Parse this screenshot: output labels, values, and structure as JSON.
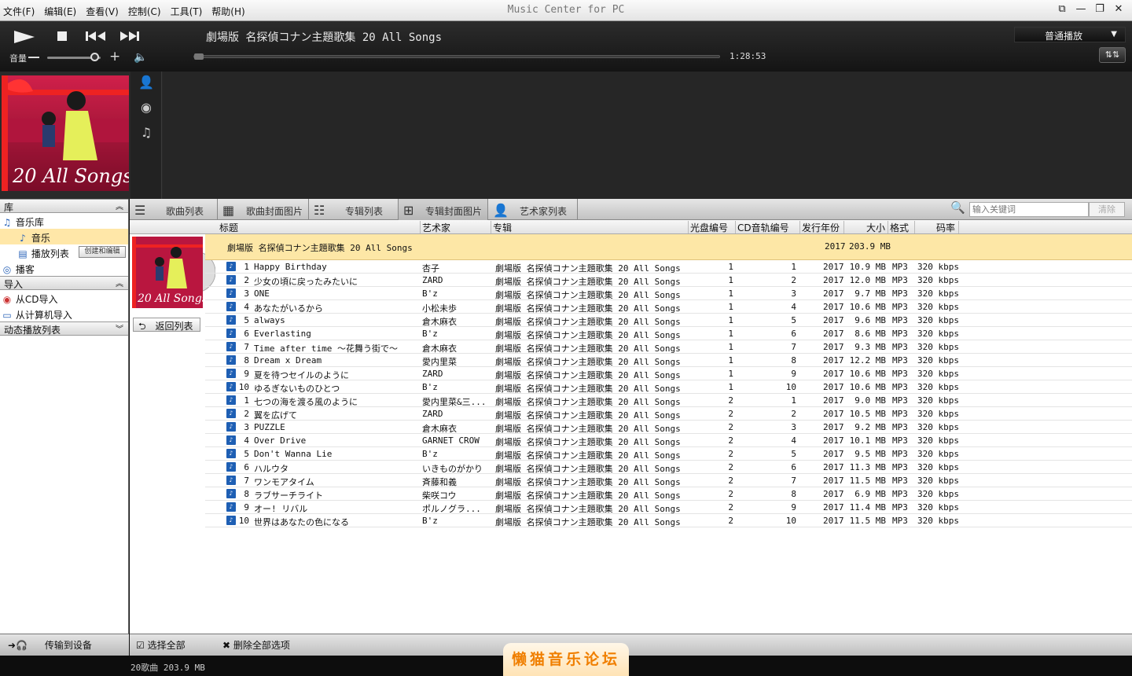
{
  "window": {
    "title": "Music Center for PC",
    "controls": [
      "⧉",
      "—",
      "❐",
      "✕"
    ]
  },
  "menu": [
    "文件(F)",
    "编辑(E)",
    "查看(V)",
    "控制(C)",
    "工具(T)",
    "帮助(H)"
  ],
  "player": {
    "now_playing": "劇場版 名探偵コナン主題歌集 20 All Songs",
    "volume_label": "音量",
    "volume_level": 0.9,
    "position": 0.0,
    "time": "1:28:53",
    "mode": "普通播放",
    "eq_icon": "equalizer-icon"
  },
  "sidebar": {
    "library_header": "库",
    "music_library": "音乐库",
    "music": "音乐",
    "playlists": "播放列表",
    "create_edit": "创建和编辑",
    "podcast": "播客",
    "import_header": "导入",
    "from_cd": "从CD导入",
    "from_pc": "从计算机导入",
    "dynamic_header": "动态播放列表",
    "transfer": "传输到设备"
  },
  "tabs": [
    "歌曲列表",
    "歌曲封面图片",
    "专辑列表",
    "专辑封面图片",
    "艺术家列表"
  ],
  "active_tab": 3,
  "search": {
    "placeholder": "输入关键词",
    "clear": "清除"
  },
  "columns": {
    "title": "标题",
    "artist": "艺术家",
    "album": "专辑",
    "disc": "光盘编号",
    "track": "CD音轨编号",
    "year": "发行年份",
    "size": "大小",
    "format": "格式",
    "bitrate": "码率"
  },
  "album": {
    "name": "劇場版 名探偵コナン主題歌集 20 All Songs",
    "year": "2017",
    "size": "203.9 MB",
    "back": "返回列表"
  },
  "songs": [
    {
      "n": "1",
      "title": "Happy Birthday",
      "artist": "杏子",
      "disc": "1",
      "track": "1",
      "size": "10.9 MB"
    },
    {
      "n": "2",
      "title": "少女の頃に戻ったみたいに",
      "artist": "ZARD",
      "disc": "1",
      "track": "2",
      "size": "12.0 MB"
    },
    {
      "n": "3",
      "title": "ONE",
      "artist": "B'z",
      "disc": "1",
      "track": "3",
      "size": "9.7 MB"
    },
    {
      "n": "4",
      "title": "あなたがいるから",
      "artist": "小松未歩",
      "disc": "1",
      "track": "4",
      "size": "10.6 MB"
    },
    {
      "n": "5",
      "title": "always",
      "artist": "倉木麻衣",
      "disc": "1",
      "track": "5",
      "size": "9.6 MB"
    },
    {
      "n": "6",
      "title": "Everlasting",
      "artist": "B'z",
      "disc": "1",
      "track": "6",
      "size": "8.6 MB"
    },
    {
      "n": "7",
      "title": "Time after time ～花舞う街で～",
      "artist": "倉木麻衣",
      "disc": "1",
      "track": "7",
      "size": "9.3 MB"
    },
    {
      "n": "8",
      "title": "Dream x Dream",
      "artist": "愛内里菜",
      "disc": "1",
      "track": "8",
      "size": "12.2 MB"
    },
    {
      "n": "9",
      "title": "夏を待つセイルのように",
      "artist": "ZARD",
      "disc": "1",
      "track": "9",
      "size": "10.6 MB"
    },
    {
      "n": "10",
      "title": "ゆるぎないものひとつ",
      "artist": "B'z",
      "disc": "1",
      "track": "10",
      "size": "10.6 MB"
    },
    {
      "n": "1",
      "title": "七つの海を渡る風のように",
      "artist": "愛内里菜&三...",
      "disc": "2",
      "track": "1",
      "size": "9.0 MB"
    },
    {
      "n": "2",
      "title": "翼を広げて",
      "artist": "ZARD",
      "disc": "2",
      "track": "2",
      "size": "10.5 MB"
    },
    {
      "n": "3",
      "title": "PUZZLE",
      "artist": "倉木麻衣",
      "disc": "2",
      "track": "3",
      "size": "9.2 MB"
    },
    {
      "n": "4",
      "title": "Over Drive",
      "artist": "GARNET CROW",
      "disc": "2",
      "track": "4",
      "size": "10.1 MB"
    },
    {
      "n": "5",
      "title": "Don't Wanna Lie",
      "artist": "B'z",
      "disc": "2",
      "track": "5",
      "size": "9.5 MB"
    },
    {
      "n": "6",
      "title": "ハルウタ",
      "artist": "いきものがかり",
      "disc": "2",
      "track": "6",
      "size": "11.3 MB"
    },
    {
      "n": "7",
      "title": "ワンモアタイム",
      "artist": "斉藤和義",
      "disc": "2",
      "track": "7",
      "size": "11.5 MB"
    },
    {
      "n": "8",
      "title": "ラブサーチライト",
      "artist": "柴咲コウ",
      "disc": "2",
      "track": "8",
      "size": "6.9 MB"
    },
    {
      "n": "9",
      "title": "オー! リバル",
      "artist": "ポルノグラ...",
      "disc": "2",
      "track": "9",
      "size": "11.4 MB"
    },
    {
      "n": "10",
      "title": "世界はあなたの色になる",
      "artist": "B'z",
      "disc": "2",
      "track": "10",
      "size": "11.5 MB"
    }
  ],
  "song_common": {
    "album": "劇場版 名探偵コナン主題歌集 20 All Songs",
    "year": "2017",
    "format": "MP3",
    "bitrate": "320 kbps"
  },
  "bottom": {
    "select_all": "选择全部",
    "delete_all": "删除全部选项"
  },
  "status": "20歌曲 203.9 MB",
  "watermark": "懒猫音乐论坛",
  "cover_text": "20 All Songs"
}
